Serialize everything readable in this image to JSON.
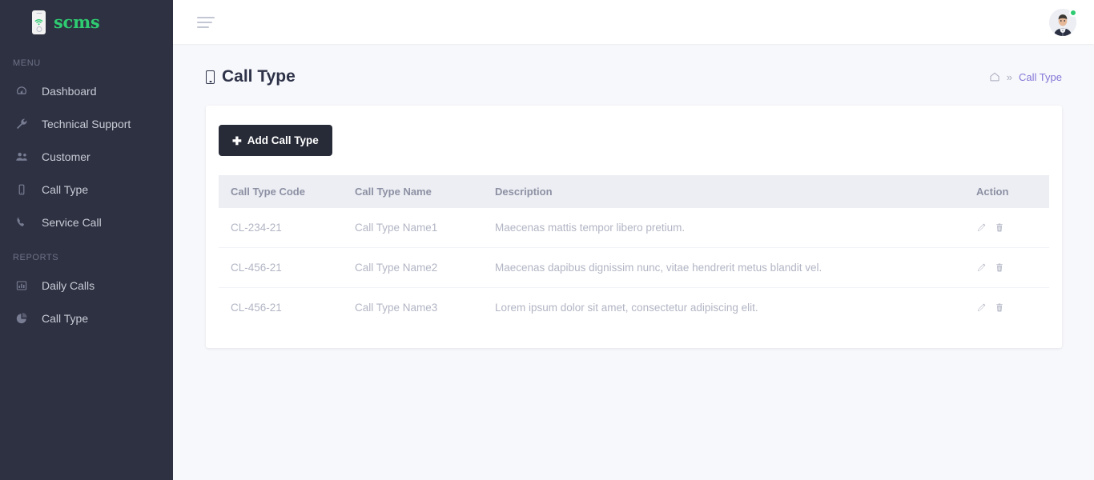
{
  "brand": {
    "name": "scms",
    "logo_icon": "mobile-wifi-icon",
    "accent_color": "#2ecb71"
  },
  "sidebar": {
    "bg_color": "#2e3141",
    "sections": [
      {
        "label": "MENU",
        "items": [
          {
            "label": "Dashboard",
            "icon": "dashboard-speedometer-icon"
          },
          {
            "label": "Technical Support",
            "icon": "wrench-icon"
          },
          {
            "label": "Customer",
            "icon": "users-icon"
          },
          {
            "label": "Call Type",
            "icon": "mobile-icon"
          },
          {
            "label": "Service Call",
            "icon": "phone-icon"
          }
        ]
      },
      {
        "label": "REPORTS",
        "items": [
          {
            "label": "Daily Calls",
            "icon": "bar-chart-icon"
          },
          {
            "label": "Call Type",
            "icon": "pie-chart-icon"
          }
        ]
      }
    ]
  },
  "topbar": {
    "menu_toggle_icon": "hamburger-icon",
    "avatar_icon": "user-avatar",
    "status": "online",
    "status_color": "#2ecb71"
  },
  "page": {
    "title": "Call Type",
    "title_icon": "mobile-icon",
    "breadcrumb": {
      "home_icon": "home-icon",
      "separator": "»",
      "current": "Call Type"
    }
  },
  "card": {
    "add_button": {
      "label": "Add Call Type",
      "icon": "plus-icon"
    },
    "table": {
      "columns": [
        "Call Type Code",
        "Call Type Name",
        "Description",
        "Action"
      ],
      "rows": [
        {
          "code": "CL-234-21",
          "name": "Call Type Name1",
          "description": "Maecenas mattis tempor libero pretium.",
          "actions": [
            "edit-pencil-icon",
            "delete-trash-icon"
          ]
        },
        {
          "code": "CL-456-21",
          "name": "Call Type Name2",
          "description": "Maecenas dapibus dignissim nunc, vitae hendrerit metus blandit vel.",
          "actions": [
            "edit-pencil-icon",
            "delete-trash-icon"
          ]
        },
        {
          "code": "CL-456-21",
          "name": "Call Type Name3",
          "description": "Lorem ipsum dolor sit amet, consectetur adipiscing elit.",
          "actions": [
            "edit-pencil-icon",
            "delete-trash-icon"
          ]
        }
      ]
    }
  }
}
